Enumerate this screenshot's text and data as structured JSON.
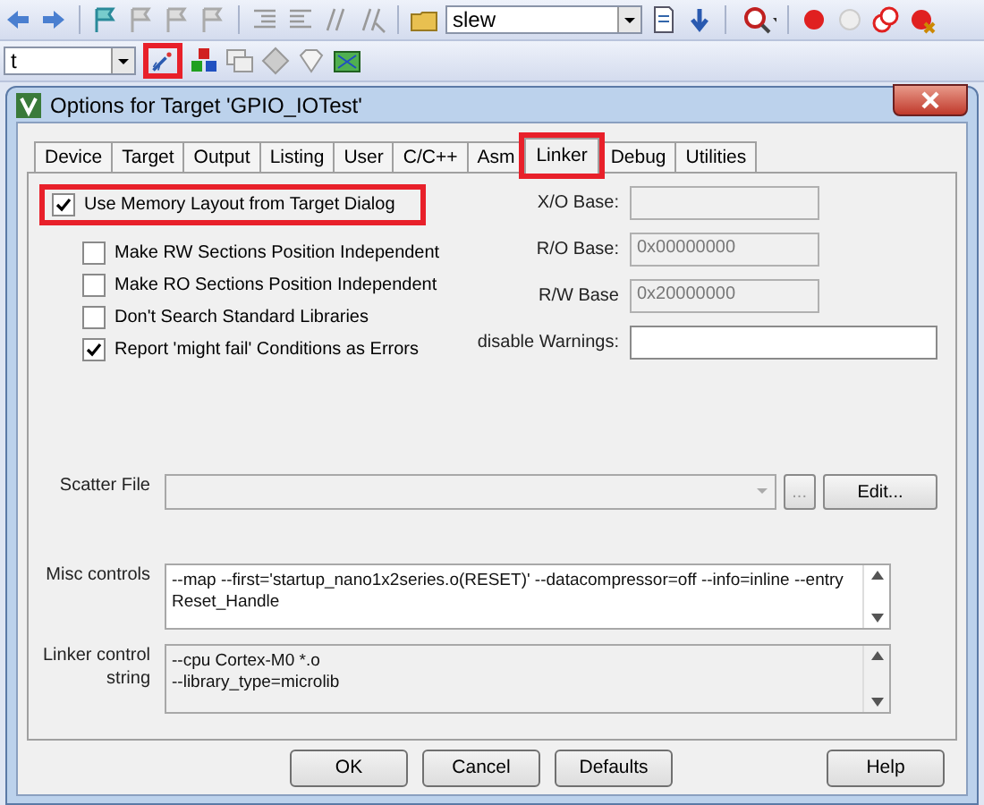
{
  "toolbar": {
    "build_target": {
      "value": "slew"
    },
    "target_select": {
      "value": "t"
    },
    "options_button": {
      "highlighted": true
    }
  },
  "dialog": {
    "title": "Options for Target 'GPIO_IOTest'"
  },
  "tabs": [
    {
      "label": "Device",
      "selected": false,
      "highlighted": false
    },
    {
      "label": "Target",
      "selected": false,
      "highlighted": false
    },
    {
      "label": "Output",
      "selected": false,
      "highlighted": false
    },
    {
      "label": "Listing",
      "selected": false,
      "highlighted": false
    },
    {
      "label": "User",
      "selected": false,
      "highlighted": false
    },
    {
      "label": "C/C++",
      "selected": false,
      "highlighted": false
    },
    {
      "label": "Asm",
      "selected": false,
      "highlighted": false
    },
    {
      "label": "Linker",
      "selected": true,
      "highlighted": true
    },
    {
      "label": "Debug",
      "selected": false,
      "highlighted": false
    },
    {
      "label": "Utilities",
      "selected": false,
      "highlighted": false
    }
  ],
  "options": [
    {
      "label": "Use Memory Layout from Target Dialog",
      "checked": true,
      "highlighted": true
    },
    {
      "label": "Make RW Sections Position Independent",
      "checked": false,
      "highlighted": false
    },
    {
      "label": "Make RO Sections Position Independent",
      "checked": false,
      "highlighted": false
    },
    {
      "label": "Don't Search Standard Libraries",
      "checked": false,
      "highlighted": false
    },
    {
      "label": "Report 'might fail' Conditions as Errors",
      "checked": true,
      "highlighted": false
    }
  ],
  "bases": [
    {
      "label": "X/O Base:",
      "disabled": true
    },
    {
      "label": "R/O Base:",
      "value": "0x00000000",
      "disabled": true
    },
    {
      "label": "R/W Base",
      "value": "0x20000000",
      "disabled": true
    },
    {
      "label": "disable Warnings:",
      "disabled": false
    }
  ],
  "scatter_file": {
    "label": "Scatter File",
    "disabled": true,
    "browse": "...",
    "edit": "Edit..."
  },
  "misc_controls": {
    "label": "Misc controls",
    "value": "--map --first='startup_nano1x2series.o(RESET)' --datacompressor=off --info=inline --entry Reset_Handle"
  },
  "linker_control": {
    "label": "Linker control string",
    "lines": [
      "--cpu Cortex-M0 *.o",
      "--library_type=microlib"
    ]
  },
  "buttons": [
    {
      "label": "OK",
      "kind": "main"
    },
    {
      "label": "Cancel",
      "kind": "main"
    },
    {
      "label": "Defaults",
      "kind": "main"
    },
    {
      "label": "Help",
      "kind": "help"
    }
  ]
}
